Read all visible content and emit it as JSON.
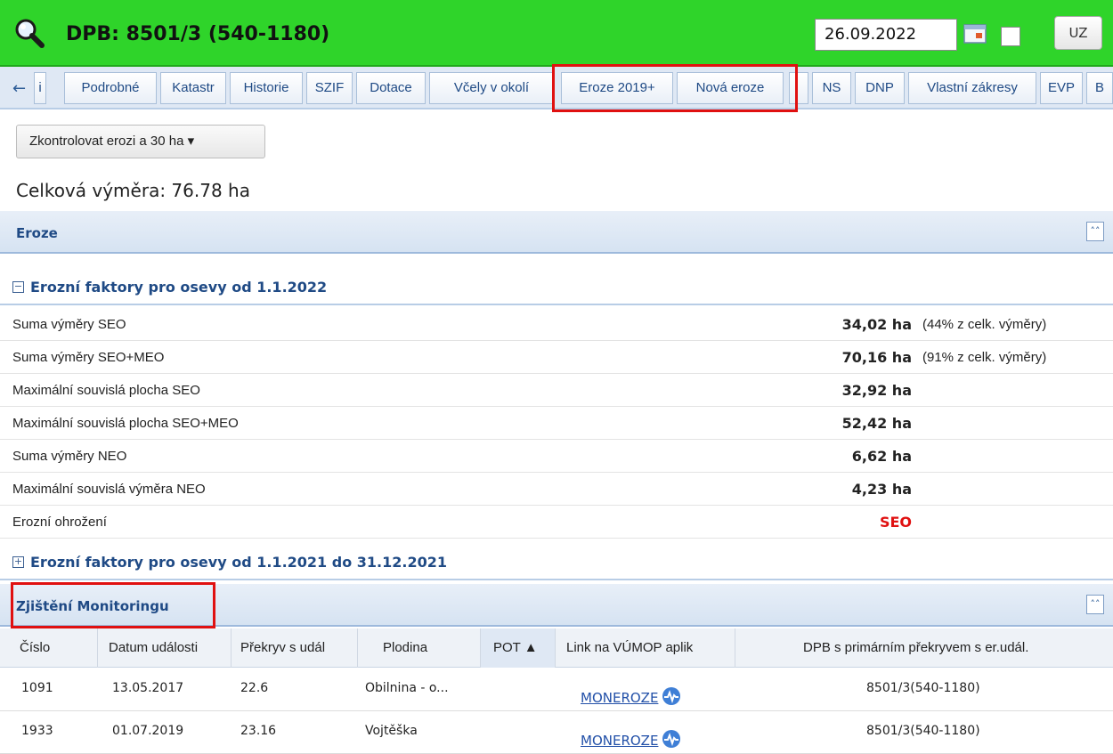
{
  "header": {
    "title": "DPB: 8501/3 (540-1180)",
    "date_value": "26.09.2022",
    "uz_label": "UZ",
    "accent_color": "#2fd42a"
  },
  "tabs": [
    {
      "label": "i"
    },
    {
      "label": "Podrobné"
    },
    {
      "label": "Katastr"
    },
    {
      "label": "Historie"
    },
    {
      "label": "SZIF"
    },
    {
      "label": "Dotace"
    },
    {
      "label": "Včely v okolí"
    },
    {
      "label": "Eroze 2019+"
    },
    {
      "label": "Nová eroze"
    },
    {
      "label": "NS"
    },
    {
      "label": "DNP"
    },
    {
      "label": "Vlastní zákresy"
    },
    {
      "label": "EVP"
    },
    {
      "label": "B"
    }
  ],
  "toolbar": {
    "dropdown_label": "Zkontrolovat erozi a 30 ha ▾",
    "total_area": "Celková výměra: 76.78 ha"
  },
  "sections": {
    "eroze": "Eroze",
    "group_2022": "Erozní faktory pro osevy od 1.1.2022",
    "group_2021": "Erozní faktory pro osevy od 1.1.2021 do 31.12.2021",
    "monitoring": "Zjištění Monitoringu"
  },
  "factors": [
    {
      "label": "Suma výměry SEO",
      "value": "34,02 ha",
      "note": "(44% z celk. výměry)"
    },
    {
      "label": "Suma výměry SEO+MEO",
      "value": "70,16 ha",
      "note": "(91% z celk. výměry)"
    },
    {
      "label": "Maximální souvislá plocha SEO",
      "value": "32,92 ha",
      "note": ""
    },
    {
      "label": "Maximální souvislá plocha SEO+MEO",
      "value": "52,42 ha",
      "note": ""
    },
    {
      "label": "Suma výměry NEO",
      "value": "6,62 ha",
      "note": ""
    },
    {
      "label": "Maximální souvislá výměra NEO",
      "value": "4,23 ha",
      "note": ""
    },
    {
      "label": "Erozní ohrožení",
      "value": "SEO",
      "note": ""
    }
  ],
  "table": {
    "columns": [
      "Číslo",
      "Datum události",
      "Překryv s udál",
      "Plodina",
      "POT ▲",
      "Link na VÚMOP aplik",
      "DPB s primárním překryvem s er.udál."
    ],
    "rows": [
      {
        "cislo": "1091",
        "datum": "13.05.2017",
        "prekryv": "22.6",
        "plodina": "Obilnina - o...",
        "link": "MONEROZE",
        "dpb": "8501/3(540-1180)"
      },
      {
        "cislo": "1933",
        "datum": "01.07.2019",
        "prekryv": "23.16",
        "plodina": "Vojtěška",
        "link": "MONEROZE",
        "dpb": "8501/3(540-1180)"
      }
    ]
  }
}
